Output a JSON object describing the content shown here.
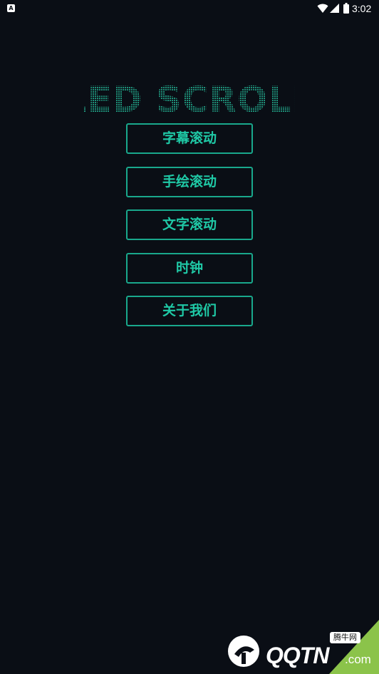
{
  "status_bar": {
    "notification_icon": "A",
    "time": "3:02",
    "icons": [
      "wifi-icon",
      "cell-signal-icon",
      "battery-icon"
    ]
  },
  "app": {
    "logo_text": "LED SCROLL",
    "accent_color": "#1fc9a6",
    "background_color": "#0a0e15"
  },
  "menu": {
    "items": [
      {
        "label": "字幕滚动"
      },
      {
        "label": "手绘滚动"
      },
      {
        "label": "文字滚动"
      },
      {
        "label": "时钟"
      },
      {
        "label": "关于我们"
      }
    ]
  },
  "watermark": {
    "badge": "腾牛网",
    "text": "QQTN",
    "suffix": ".com"
  }
}
